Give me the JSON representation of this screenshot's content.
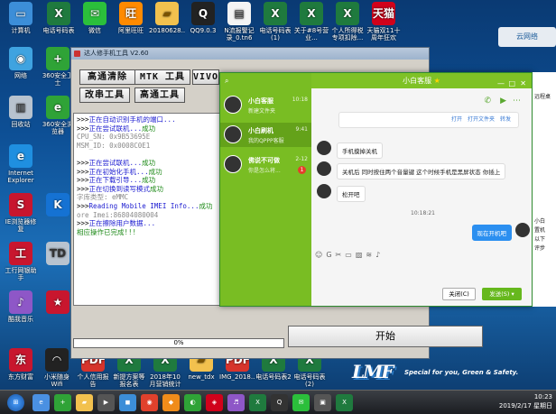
{
  "desktop": {
    "col1": [
      {
        "label": "计算机",
        "cls": "pc",
        "glyph": "▭"
      },
      {
        "label": "网络",
        "cls": "net",
        "glyph": "◉"
      },
      {
        "label": "回收站",
        "cls": "gh",
        "glyph": "▥"
      },
      {
        "label": "Internet Explorer",
        "cls": "ie",
        "glyph": "e"
      },
      {
        "label": "IE浏览器修复",
        "cls": "red",
        "glyph": "S"
      },
      {
        "label": "工行网银助手",
        "cls": "red",
        "glyph": "工"
      },
      {
        "label": "酷我音乐",
        "cls": "pic",
        "glyph": "♪"
      }
    ],
    "col2": [
      {
        "label": "360安全卫士",
        "cls": "s360",
        "glyph": "+"
      },
      {
        "label": "360安全浏览器",
        "cls": "s360",
        "glyph": "e"
      },
      {
        "label": "",
        "cls": "kw",
        "glyph": "K"
      },
      {
        "label": "",
        "cls": "gh",
        "glyph": "TD"
      },
      {
        "label": "",
        "cls": "red",
        "glyph": "★"
      }
    ],
    "top_row": [
      {
        "label": "电话号码表",
        "cls": "xl",
        "glyph": "X"
      },
      {
        "label": "微信",
        "cls": "wx",
        "glyph": "✉"
      },
      {
        "label": "阿里旺旺",
        "cls": "ali",
        "glyph": "旺"
      },
      {
        "label": "20180628...",
        "cls": "fol",
        "glyph": "▰"
      },
      {
        "label": "QQ9.0.3",
        "cls": "qq",
        "glyph": "Q"
      },
      {
        "label": "N流报警记录_0.tn6",
        "cls": "doc",
        "glyph": "▤"
      },
      {
        "label": "电话号码表(1)",
        "cls": "xl",
        "glyph": "X"
      },
      {
        "label": "关于#8号营业...",
        "cls": "xl",
        "glyph": "X"
      },
      {
        "label": "个人所得税专项扣除...",
        "cls": "xl",
        "glyph": "X"
      },
      {
        "label": "天猫双11十周年狂欢",
        "cls": "tm",
        "glyph": "天猫"
      }
    ],
    "bottom_row": [
      {
        "label": "东方财富",
        "cls": "red",
        "glyph": "东"
      },
      {
        "label": "小米随身Wifi",
        "cls": "qq",
        "glyph": "◠"
      },
      {
        "label": "个人信用报告",
        "cls": "pdf",
        "glyph": "PDF"
      },
      {
        "label": "新提方案等报名表",
        "cls": "xl",
        "glyph": "X"
      },
      {
        "label": "2018年10月营销统计",
        "cls": "xl",
        "glyph": "X"
      },
      {
        "label": "new_tdx",
        "cls": "fol",
        "glyph": "▰"
      },
      {
        "label": "IMG_2018...",
        "cls": "pdf",
        "glyph": "PDF"
      },
      {
        "label": "电话号码表2",
        "cls": "xl",
        "glyph": "X"
      },
      {
        "label": "电话号码表(2)",
        "cls": "xl",
        "glyph": "X"
      }
    ],
    "widget_label": "云网络"
  },
  "flasher": {
    "title": "达人修手机工具 V2.60",
    "buttons_row1": [
      "高通清除",
      "MTK 工具",
      "VIVO"
    ],
    "buttons_row2": [
      "改串工具",
      "高通工具"
    ],
    "log": [
      {
        "parts": [
          {
            "t": ">>>",
            "c": "pfx"
          },
          {
            "t": "正在自动识别手机的端口...",
            "c": "blue"
          }
        ]
      },
      {
        "parts": [
          {
            "t": ">>>",
            "c": "pfx"
          },
          {
            "t": "正在尝试联机...",
            "c": "blue"
          },
          {
            "t": "成功",
            "c": "green"
          }
        ]
      },
      {
        "parts": [
          {
            "t": "    CPU_SN:  0x9B53695E",
            "c": "gray"
          }
        ]
      },
      {
        "parts": [
          {
            "t": "    MSM_ID:  0x0008C0E1",
            "c": "gray"
          }
        ]
      },
      {
        "parts": [
          {
            "t": "",
            "c": "pfx"
          }
        ]
      },
      {
        "parts": [
          {
            "t": ">>>",
            "c": "pfx"
          },
          {
            "t": "正在尝试联机...",
            "c": "blue"
          },
          {
            "t": "成功",
            "c": "green"
          }
        ]
      },
      {
        "parts": [
          {
            "t": ">>>",
            "c": "pfx"
          },
          {
            "t": "正在初始化手机...",
            "c": "blue"
          },
          {
            "t": "成功",
            "c": "green"
          }
        ]
      },
      {
        "parts": [
          {
            "t": ">>>",
            "c": "pfx"
          },
          {
            "t": "正在下载引导...",
            "c": "blue"
          },
          {
            "t": "成功",
            "c": "green"
          }
        ]
      },
      {
        "parts": [
          {
            "t": ">>>",
            "c": "pfx"
          },
          {
            "t": "正在切换到读写模式",
            "c": "blue"
          },
          {
            "t": "成功",
            "c": "green"
          }
        ]
      },
      {
        "parts": [
          {
            "t": "    字库类型:  eMMC",
            "c": "gray"
          }
        ]
      },
      {
        "parts": [
          {
            "t": ">>>",
            "c": "pfx"
          },
          {
            "t": "Reading Mobile IMEI Info...",
            "c": "blue"
          },
          {
            "t": "成功",
            "c": "green"
          }
        ]
      },
      {
        "parts": [
          {
            "t": "    ore Imei:86804080004",
            "c": "gray"
          }
        ]
      },
      {
        "parts": [
          {
            "t": ">>>",
            "c": "pfx"
          },
          {
            "t": "正在擦除用户数据...",
            "c": "blue"
          }
        ]
      },
      {
        "parts": [
          {
            "t": "    相应操作已完成!!!",
            "c": "green"
          }
        ]
      }
    ],
    "progress_text": "0%",
    "progress_value": 0,
    "start_label": "开始"
  },
  "chat": {
    "title": "小白客服",
    "contacts": [
      {
        "name": "小白客服",
        "msg": "新建文件夹",
        "time": "10:18",
        "badge": ""
      },
      {
        "name": "小白刷机",
        "msg": "我的QPPP客服",
        "time": "9:41",
        "badge": ""
      },
      {
        "name": "佛说不可做",
        "msg": "你是怎么将...",
        "time": "2-12",
        "badge": "1"
      }
    ],
    "file_actions": [
      "打开",
      "打开文件夹",
      "转发"
    ],
    "messages": [
      {
        "from": "them",
        "text": "手机摸掉关机"
      },
      {
        "from": "them",
        "text": "关机后 同时按住两个音量键 这个时候手机是黑屏状态 你插上"
      },
      {
        "from": "them",
        "text": "松开吧"
      },
      {
        "from": "time",
        "text": "10:18:21"
      },
      {
        "from": "me",
        "text": "现在开机吧"
      }
    ],
    "close_label": "关闭(C)",
    "send_label": "发送(S)"
  },
  "rightcol": [
    "远程桌",
    "小白",
    "置机",
    "以下",
    "评步"
  ],
  "brand": {
    "logo": "LMF",
    "slogan": "Special for you, Green & Safety."
  },
  "taskbar": {
    "time": "10:23",
    "date": "2019/2/17 星期日"
  }
}
